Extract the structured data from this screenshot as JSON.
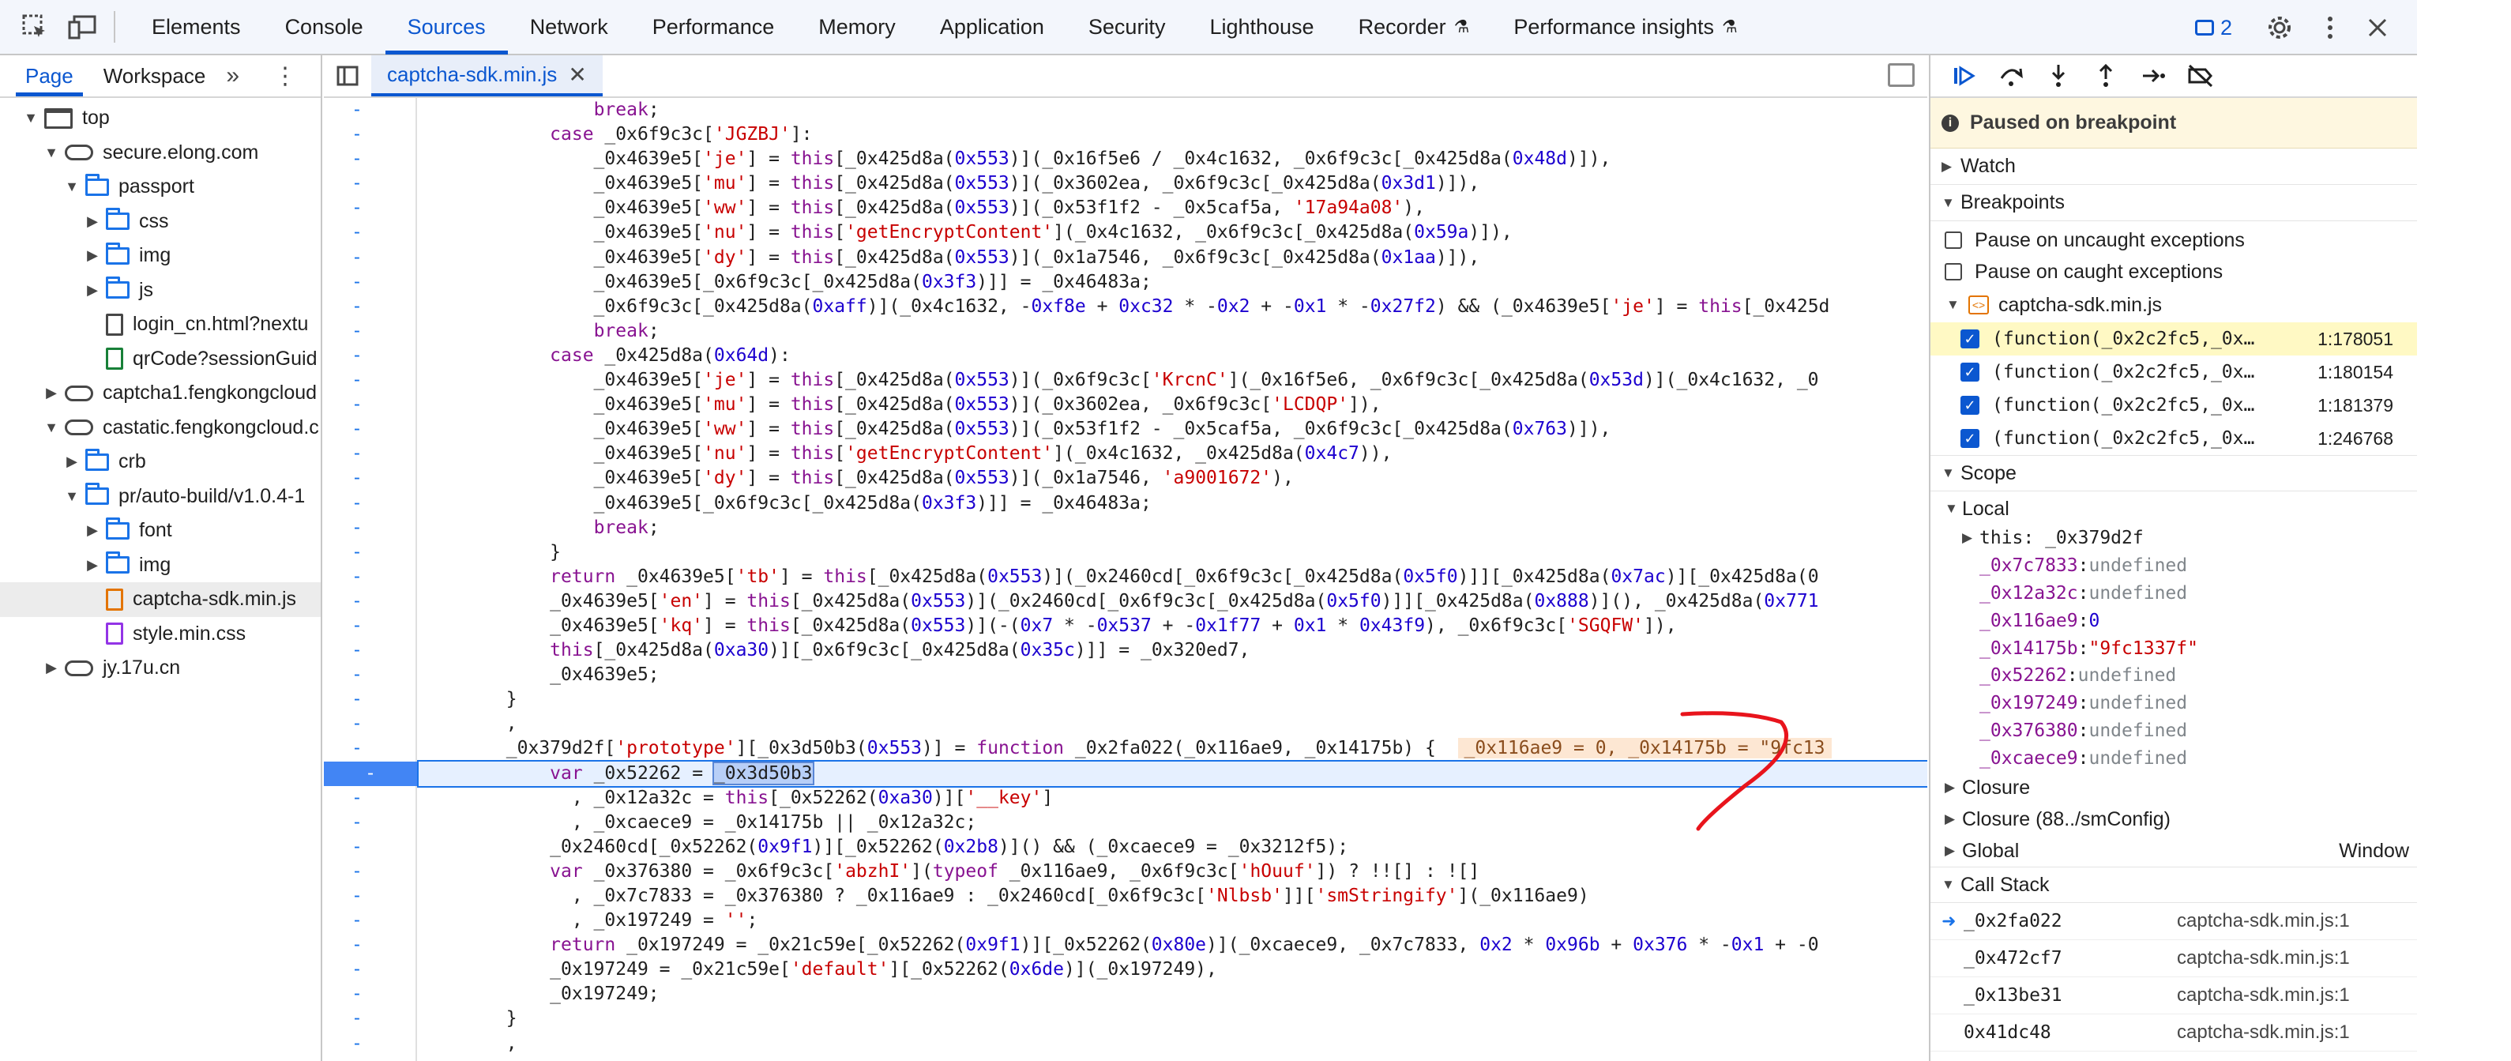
{
  "toolbar": {
    "tabs": [
      "Elements",
      "Console",
      "Sources",
      "Network",
      "Performance",
      "Memory",
      "Application",
      "Security",
      "Lighthouse",
      "Recorder",
      "Performance insights"
    ],
    "active_tab": "Sources",
    "issues_count": "2"
  },
  "navigator": {
    "tabs": [
      "Page",
      "Workspace"
    ],
    "tree": [
      {
        "label": "top",
        "indent": 0,
        "icon": "frame",
        "arrow": "down"
      },
      {
        "label": "secure.elong.com",
        "indent": 1,
        "icon": "cloud",
        "arrow": "down"
      },
      {
        "label": "passport",
        "indent": 2,
        "icon": "folder",
        "arrow": "down"
      },
      {
        "label": "css",
        "indent": 3,
        "icon": "folder",
        "arrow": "right"
      },
      {
        "label": "img",
        "indent": 3,
        "icon": "folder",
        "arrow": "right"
      },
      {
        "label": "js",
        "indent": 3,
        "icon": "folder",
        "arrow": "right"
      },
      {
        "label": "login_cn.html?nextu",
        "indent": 3,
        "icon": "doc",
        "arrow": "none"
      },
      {
        "label": "qrCode?sessionGuid",
        "indent": 3,
        "icon": "doc-green",
        "arrow": "none"
      },
      {
        "label": "captcha1.fengkongcloud",
        "indent": 1,
        "icon": "cloud",
        "arrow": "right"
      },
      {
        "label": "castatic.fengkongcloud.c",
        "indent": 1,
        "icon": "cloud",
        "arrow": "down"
      },
      {
        "label": "crb",
        "indent": 2,
        "icon": "folder",
        "arrow": "right"
      },
      {
        "label": "pr/auto-build/v1.0.4-1",
        "indent": 2,
        "icon": "folder",
        "arrow": "down"
      },
      {
        "label": "font",
        "indent": 3,
        "icon": "folder",
        "arrow": "right"
      },
      {
        "label": "img",
        "indent": 3,
        "icon": "folder",
        "arrow": "right"
      },
      {
        "label": "captcha-sdk.min.js",
        "indent": 3,
        "icon": "doc-orange",
        "arrow": "none",
        "selected": true
      },
      {
        "label": "style.min.css",
        "indent": 3,
        "icon": "doc-purple",
        "arrow": "none"
      },
      {
        "label": "jy.17u.cn",
        "indent": 1,
        "icon": "cloud",
        "arrow": "right"
      }
    ]
  },
  "editor": {
    "file_tab": "captcha-sdk.min.js",
    "lines": [
      "                break;",
      "            case _0x6f9c3c['JGZBJ']:",
      "                _0x4639e5['je'] = this[_0x425d8a(0x553)](_0x16f5e6 / _0x4c1632, _0x6f9c3c[_0x425d8a(0x48d)]),",
      "                _0x4639e5['mu'] = this[_0x425d8a(0x553)](_0x3602ea, _0x6f9c3c[_0x425d8a(0x3d1)]),",
      "                _0x4639e5['ww'] = this[_0x425d8a(0x553)](_0x53f1f2 - _0x5caf5a, '17a94a08'),",
      "                _0x4639e5['nu'] = this['getEncryptContent'](_0x4c1632, _0x6f9c3c[_0x425d8a(0x59a)]),",
      "                _0x4639e5['dy'] = this[_0x425d8a(0x553)](_0x1a7546, _0x6f9c3c[_0x425d8a(0x1aa)]),",
      "                _0x4639e5[_0x6f9c3c[_0x425d8a(0x3f3)]] = _0x46483a;",
      "                _0x6f9c3c[_0x425d8a(0xaff)](_0x4c1632, -0xf8e + 0xc32 * -0x2 + -0x1 * -0x27f2) && (_0x4639e5['je'] = this[_0x425d",
      "                break;",
      "            case _0x425d8a(0x64d):",
      "                _0x4639e5['je'] = this[_0x425d8a(0x553)](_0x6f9c3c['KrcnC'](_0x16f5e6, _0x6f9c3c[_0x425d8a(0x53d)](_0x4c1632, _0",
      "                _0x4639e5['mu'] = this[_0x425d8a(0x553)](_0x3602ea, _0x6f9c3c['LCDQP']),",
      "                _0x4639e5['ww'] = this[_0x425d8a(0x553)](_0x53f1f2 - _0x5caf5a, _0x6f9c3c[_0x425d8a(0x763)]),",
      "                _0x4639e5['nu'] = this['getEncryptContent'](_0x4c1632, _0x425d8a(0x4c7)),",
      "                _0x4639e5['dy'] = this[_0x425d8a(0x553)](_0x1a7546, 'a9001672'),",
      "                _0x4639e5[_0x6f9c3c[_0x425d8a(0x3f3)]] = _0x46483a;",
      "                break;",
      "            }",
      "            return _0x4639e5['tb'] = this[_0x425d8a(0x553)](_0x2460cd[_0x6f9c3c[_0x425d8a(0x5f0)]][_0x425d8a(0x7ac)][_0x425d8a(0",
      "            _0x4639e5['en'] = this[_0x425d8a(0x553)](_0x2460cd[_0x6f9c3c[_0x425d8a(0x5f0)]][_0x425d8a(0x888)](), _0x425d8a(0x771",
      "            _0x4639e5['kq'] = this[_0x425d8a(0x553)](-(0x7 * -0x537 + -0x1f77 + 0x1 * 0x43f9), _0x6f9c3c['SGQFW']),",
      "            this[_0x425d8a(0xa30)][_0x6f9c3c[_0x425d8a(0x35c)]] = _0x320ed7,",
      "            _0x4639e5;",
      "        }",
      "        ,",
      "        _0x379d2f['prototype'][_0x3d50b3(0x553)] = function _0x2fa022(_0x116ae9, _0x14175b) {",
      "            var _0x52262 = ",
      "              , _0x12a32c = this[_0x52262(0xa30)]['__key']",
      "              , _0xcaece9 = _0x14175b || _0x12a32c;",
      "            _0x2460cd[_0x52262(0x9f1)][_0x52262(0x2b8)]() && (_0xcaece9 = _0x3212f5);",
      "            var _0x376380 = _0x6f9c3c['abzhI'](typeof _0x116ae9, _0x6f9c3c['hOuuf']) ? !![] : ![]",
      "              , _0x7c7833 = _0x376380 ? _0x116ae9 : _0x2460cd[_0x6f9c3c['Nlbsb']]['smStringify'](_0x116ae9)",
      "              , _0x197249 = '';",
      "            return _0x197249 = _0x21c59e[_0x52262(0x9f1)][_0x52262(0x80e)](_0xcaece9, _0x7c7833, 0x2 * 0x96b + 0x376 * -0x1 + -0",
      "            _0x197249 = _0x21c59e['default'][_0x52262(0x6de)](_0x197249),",
      "            _0x197249;",
      "        }",
      "        ,"
    ],
    "exec_line_index": 27,
    "exec_selected_token": "_0x3d50b3",
    "inline_values_text": "_0x116ae9 = 0, _0x14175b = \"9fc13"
  },
  "debugger": {
    "paused_text": "Paused on breakpoint",
    "sections": {
      "watch": "Watch",
      "breakpoints": "Breakpoints",
      "scope": "Scope",
      "callstack": "Call Stack"
    },
    "pause_uncaught": "Pause on uncaught exceptions",
    "pause_caught": "Pause on caught exceptions",
    "bp_file": "captcha-sdk.min.js",
    "breakpoints": [
      {
        "code": "(function(_0x2c2fc5,_0x…",
        "loc": "1:178051",
        "highlight": true
      },
      {
        "code": "(function(_0x2c2fc5,_0x…",
        "loc": "1:180154",
        "highlight": false
      },
      {
        "code": "(function(_0x2c2fc5,_0x…",
        "loc": "1:181379",
        "highlight": false
      },
      {
        "code": "(function(_0x2c2fc5,_0x…",
        "loc": "1:246768",
        "highlight": false
      }
    ],
    "scope_local": "Local",
    "scope_this": "this: _0x379d2f",
    "scope_vars": [
      {
        "name": "_0x7c7833",
        "value": "undefined",
        "kind": "undef"
      },
      {
        "name": "_0x12a32c",
        "value": "undefined",
        "kind": "undef"
      },
      {
        "name": "_0x116ae9",
        "value": "0",
        "kind": "num"
      },
      {
        "name": "_0x14175b",
        "value": "\"9fc1337f\"",
        "kind": "str"
      },
      {
        "name": "_0x52262",
        "value": "undefined",
        "kind": "undef"
      },
      {
        "name": "_0x197249",
        "value": "undefined",
        "kind": "undef"
      },
      {
        "name": "_0x376380",
        "value": "undefined",
        "kind": "undef"
      },
      {
        "name": "_0xcaece9",
        "value": "undefined",
        "kind": "undef"
      }
    ],
    "closure_1": "Closure",
    "closure_2": "Closure (88../smConfig)",
    "global": "Global",
    "global_value": "Window",
    "callstack": [
      {
        "fn": "_0x2fa022",
        "loc": "captcha-sdk.min.js:1",
        "current": true
      },
      {
        "fn": "_0x472cf7",
        "loc": "captcha-sdk.min.js:1",
        "current": false
      },
      {
        "fn": "_0x13be31",
        "loc": "captcha-sdk.min.js:1",
        "current": false
      },
      {
        "fn": "0x41dc48",
        "loc": "captcha-sdk.min.js:1",
        "current": false
      }
    ]
  },
  "colors": {
    "accent": "#0b57d0",
    "paused_bg": "#fef7e0",
    "exec_line": "#4285f4",
    "annotation": "#e8141c"
  }
}
